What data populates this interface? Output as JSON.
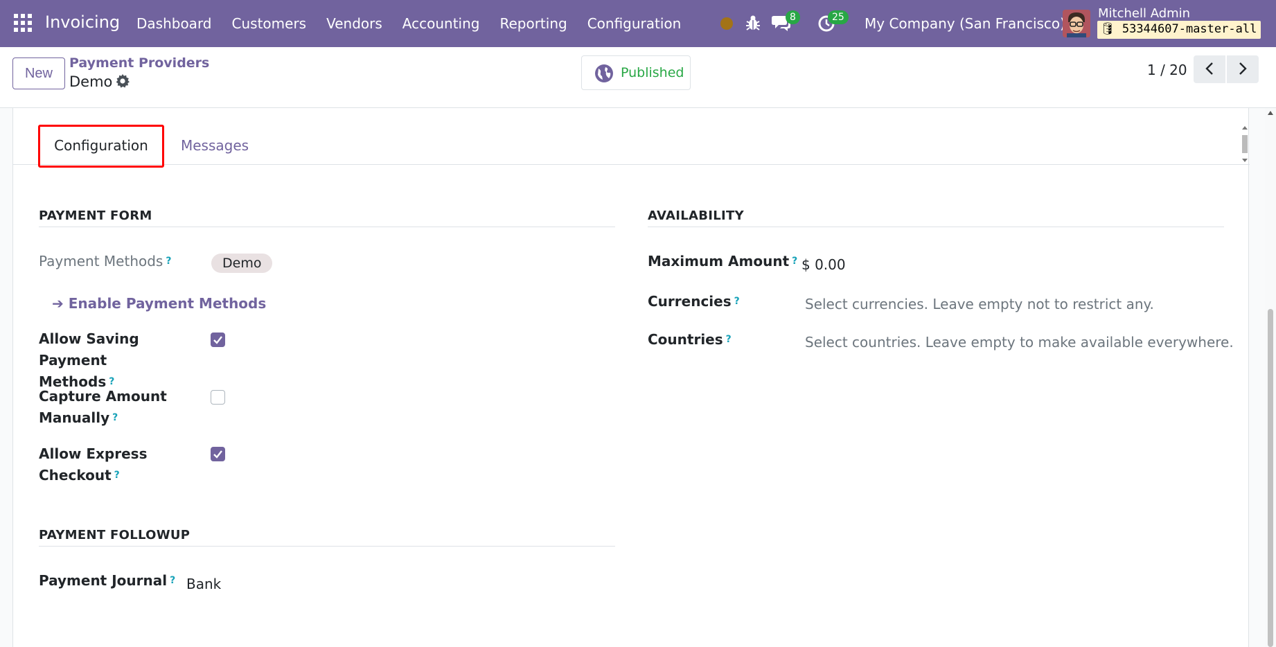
{
  "navbar": {
    "app_name": "Invoicing",
    "menu": [
      "Dashboard",
      "Customers",
      "Vendors",
      "Accounting",
      "Reporting",
      "Configuration"
    ],
    "chat_count": "8",
    "activity_count": "25",
    "company": "My Company (San Francisco)",
    "user_name": "Mitchell Admin",
    "database": "53344607-master-all"
  },
  "control_panel": {
    "new_label": "New",
    "breadcrumb": "Payment Providers",
    "record_name": "Demo",
    "published_label": "Published",
    "pager": "1 / 20"
  },
  "tabs": {
    "configuration": "Configuration",
    "messages": "Messages"
  },
  "payment_form": {
    "title": "PAYMENT FORM",
    "payment_methods_label": "Payment Methods",
    "payment_method_tag": "Demo",
    "enable_link": "Enable Payment Methods",
    "allow_saving_label_1": "Allow Saving Payment",
    "allow_saving_label_2": "Methods",
    "allow_saving": true,
    "capture_label_1": "Capture Amount",
    "capture_label_2": "Manually",
    "capture_manually": false,
    "express_label_1": "Allow Express",
    "express_label_2": "Checkout",
    "allow_express": true
  },
  "availability": {
    "title": "AVAILABILITY",
    "max_amount_label": "Maximum Amount",
    "max_amount_value": "$ 0.00",
    "currencies_label": "Currencies",
    "currencies_placeholder": "Select currencies. Leave empty not to restrict any.",
    "countries_label": "Countries",
    "countries_placeholder": "Select countries. Leave empty to make available everywhere."
  },
  "payment_followup": {
    "title": "PAYMENT FOLLOWUP",
    "journal_label": "Payment Journal",
    "journal_value": "Bank"
  },
  "help_mark": "?",
  "colors": {
    "brand": "#71639e",
    "success": "#28a745",
    "highlight": "#ff0000",
    "help": "#17a2b8"
  }
}
